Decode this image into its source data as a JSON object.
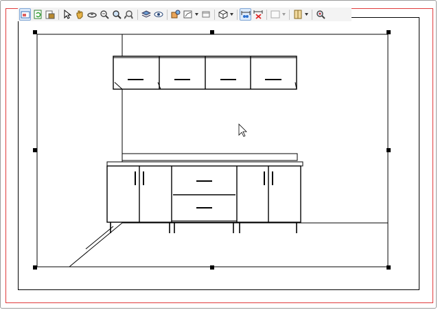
{
  "window": {
    "border_color": "#9a9a9a"
  },
  "print_area": {
    "border_color": "#e0393a"
  },
  "toolbar": {
    "buttons": [
      {
        "icon": "select-view-icon",
        "active": true
      },
      {
        "icon": "refresh-icon"
      },
      {
        "icon": "print-preview-icon"
      },
      {
        "separator": true
      },
      {
        "icon": "pointer-icon"
      },
      {
        "icon": "pan-hand-icon"
      },
      {
        "icon": "orbit-icon"
      },
      {
        "icon": "zoom-window-icon"
      },
      {
        "icon": "zoom-icon"
      },
      {
        "icon": "zoom-extents-icon"
      },
      {
        "separator": true
      },
      {
        "icon": "layers-icon"
      },
      {
        "icon": "visibility-eye-icon"
      },
      {
        "separator": true
      },
      {
        "icon": "render-style-icon"
      },
      {
        "icon": "camera-view-icon",
        "dropdown": true
      },
      {
        "icon": "frame-icon"
      },
      {
        "separator": true
      },
      {
        "icon": "3d-cube-icon",
        "dropdown": true
      },
      {
        "separator": true
      },
      {
        "icon": "add-dimension-icon",
        "active": true
      },
      {
        "icon": "delete-dimension-icon"
      },
      {
        "separator": true
      },
      {
        "icon": "color-box-icon",
        "dropdown": true
      },
      {
        "separator": true
      },
      {
        "icon": "door-panel-icon",
        "dropdown": true
      },
      {
        "separator": true
      },
      {
        "icon": "magnifier-settings-icon"
      }
    ]
  },
  "drawing": {
    "title": "",
    "wall_cabinet_doors": 4,
    "base_cabinet_doors": 4,
    "base_cabinet_drawers": 2
  }
}
